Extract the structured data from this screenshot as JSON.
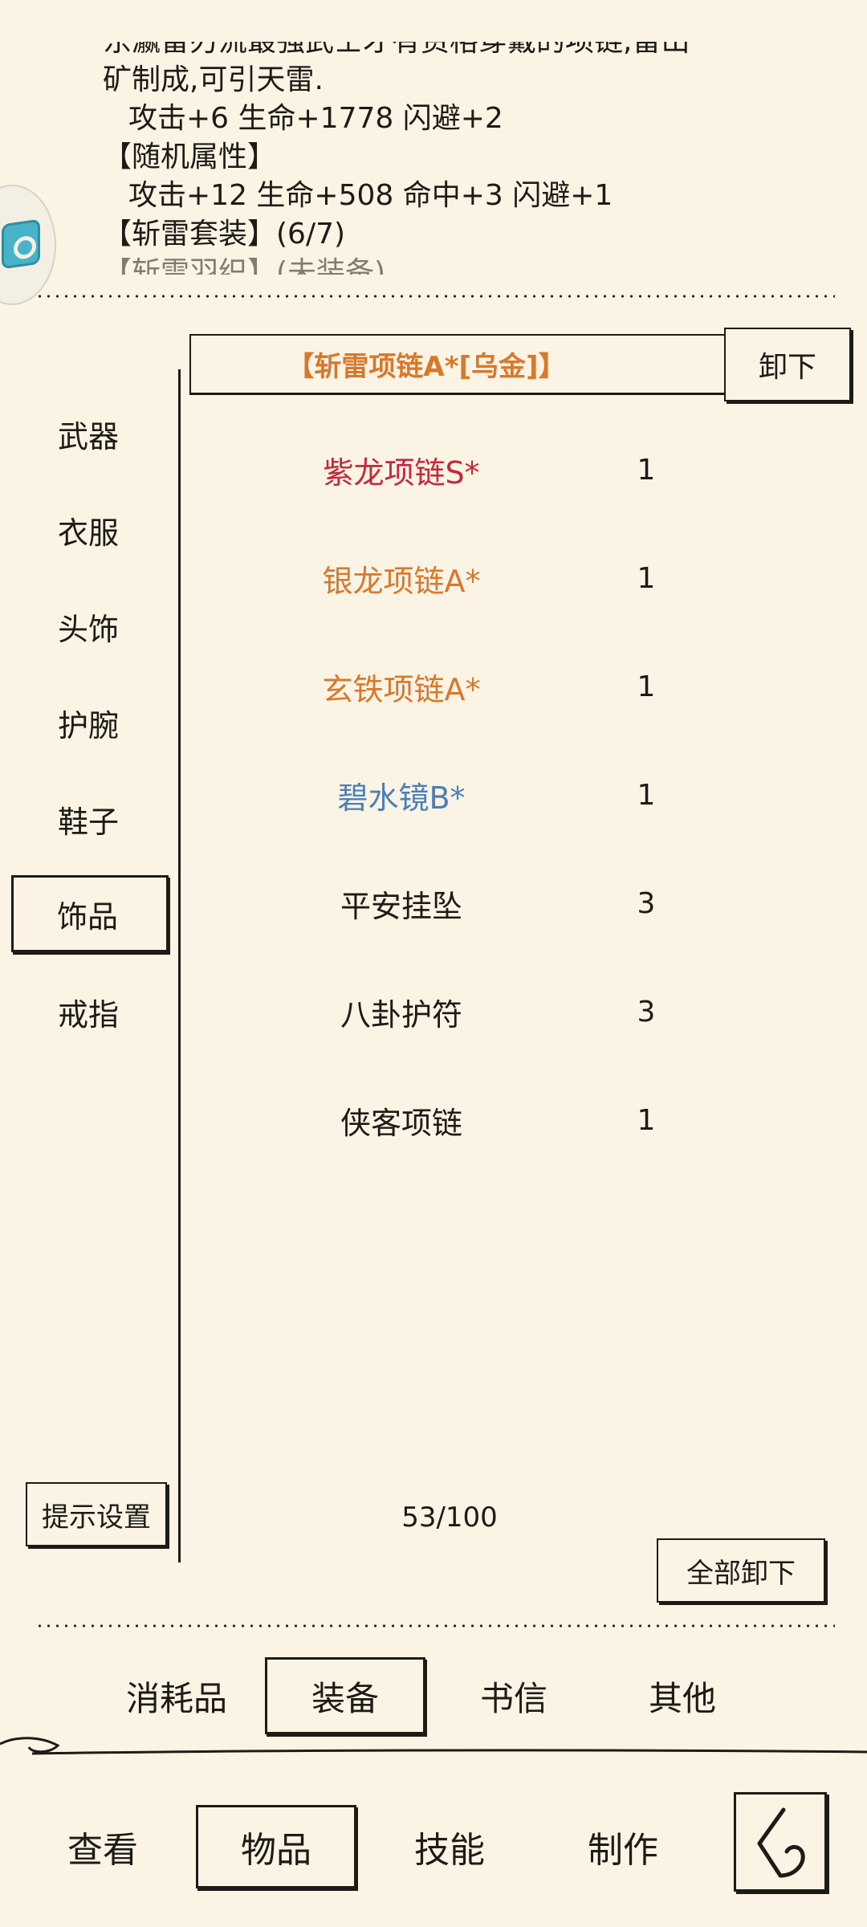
{
  "description": {
    "lines": [
      "东瀛雷刃流最强武士才有资格穿戴的项链,雷山",
      "矿制成,可引天雷.",
      "攻击+6 生命+1778 闪避+2",
      "【随机属性】",
      "攻击+12 生命+508 命中+3 闪避+1",
      "【斩雷套装】(6/7)",
      "【斩雷羽织】(未装备)"
    ]
  },
  "categories": [
    "武器",
    "衣服",
    "头饰",
    "护腕",
    "鞋子",
    "饰品",
    "戒指"
  ],
  "active_category": "饰品",
  "equipped": {
    "name": "【斩雷项链A*[乌金]】",
    "color": "#d9772a",
    "unequip_label": "卸下"
  },
  "items": [
    {
      "name": "紫龙项链S*",
      "count": "1",
      "color": "#c4283a"
    },
    {
      "name": "银龙项链A*",
      "count": "1",
      "color": "#d9772a"
    },
    {
      "name": "玄铁项链A*",
      "count": "1",
      "color": "#d9772a"
    },
    {
      "name": "碧水镜B*",
      "count": "1",
      "color": "#4a7fb8"
    },
    {
      "name": "平安挂坠",
      "count": "3",
      "color": "#1e1a16"
    },
    {
      "name": "八卦护符",
      "count": "3",
      "color": "#1e1a16"
    },
    {
      "name": "侠客项链",
      "count": "1",
      "color": "#1e1a16"
    }
  ],
  "hint_settings_label": "提示设置",
  "capacity": "53/100",
  "unequip_all_label": "全部卸下",
  "sub_tabs": [
    "消耗品",
    "装备",
    "书信",
    "其他"
  ],
  "active_sub_tab": "装备",
  "nav_tabs": [
    "查看",
    "物品",
    "技能",
    "制作"
  ],
  "active_nav_tab": "物品",
  "icons": {
    "back": "back-arrow-icon",
    "floating": "app-bubble-icon"
  }
}
